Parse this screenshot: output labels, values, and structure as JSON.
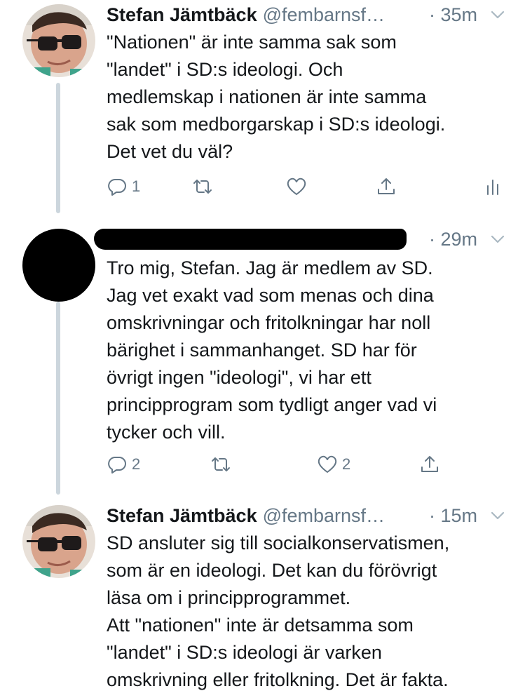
{
  "tweets": [
    {
      "author_name": "Stefan Jämtbäck",
      "handle": "@fembarnsf…",
      "time": "· 35m",
      "text_lines": [
        "\"Nationen\" är inte samma sak som",
        "\"landet\" i SD:s ideologi. Och",
        "medlemskap i nationen är inte samma",
        "sak som medborgarskap i SD:s ideologi.",
        "Det vet du väl?"
      ],
      "reply_count": "1",
      "like_count": ""
    },
    {
      "author_name": "",
      "handle": "",
      "time": "· 29m",
      "text_lines": [
        "Tro mig, Stefan. Jag är medlem av SD.",
        "Jag vet exakt vad som menas och dina",
        "omskrivningar och fritolkningar har noll",
        "bärighet i sammanhanget. SD har för",
        "övrigt ingen \"ideologi\", vi har ett",
        "principprogram som tydligt anger vad vi",
        "tycker och vill."
      ],
      "reply_count": "2",
      "like_count": "2"
    },
    {
      "author_name": "Stefan Jämtbäck",
      "handle": "@fembarnsf…",
      "time": "· 15m",
      "text_lines": [
        "SD ansluter sig till socialkonservatismen,",
        "som är en ideologi. Det kan du förövrigt",
        "läsa om i principprogrammet.",
        "Att \"nationen\" inte är detsamma som",
        "\"landet\" i SD:s ideologi är varken",
        "omskrivning eller fritolkning. Det är fakta."
      ]
    }
  ],
  "icons": {
    "reply": "reply-icon",
    "retweet": "retweet-icon",
    "like": "like-icon",
    "share": "share-icon",
    "analytics": "analytics-icon",
    "caret": "chevron-down-icon"
  },
  "colors": {
    "text": "#14171a",
    "secondary": "#657786",
    "thread_line": "#ccd6dd"
  }
}
